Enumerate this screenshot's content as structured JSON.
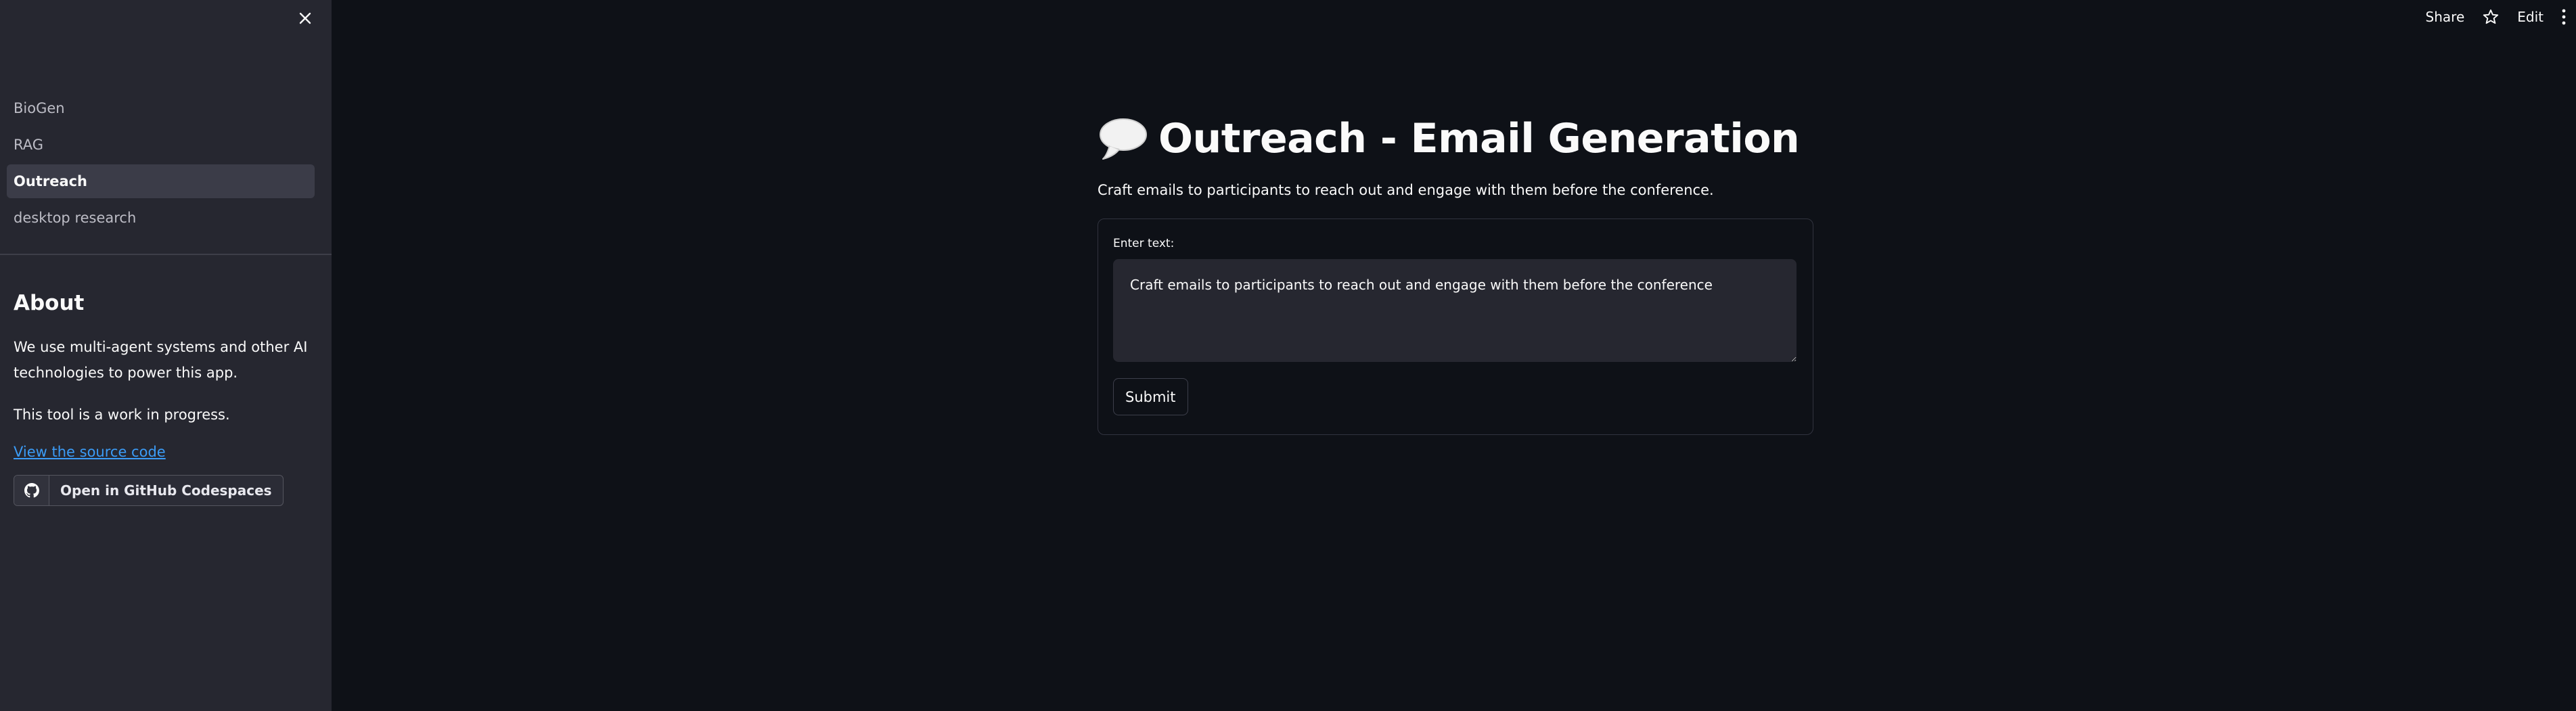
{
  "toolbar": {
    "share_label": "Share",
    "edit_label": "Edit"
  },
  "sidebar": {
    "items": [
      {
        "label": "BioGen",
        "active": false
      },
      {
        "label": "RAG",
        "active": false
      },
      {
        "label": "Outreach",
        "active": true
      },
      {
        "label": "desktop research",
        "active": false
      }
    ],
    "about": {
      "heading": "About",
      "paragraph_1": "We use multi-agent systems and other AI technologies to power this app.",
      "paragraph_2": "This tool is a work in progress.",
      "link_text": "View the source code",
      "codespaces_button": "Open in GitHub Codespaces"
    }
  },
  "main": {
    "title_icon": "speech-balloon-icon",
    "title": "Outreach - Email Generation",
    "subtitle": "Craft emails to participants to reach out and engage with them before the conference.",
    "form": {
      "label": "Enter text:",
      "textarea_value": "Craft emails to participants to reach out and engage with them before the conference",
      "submit_label": "Submit"
    }
  },
  "colors": {
    "background": "#0e1117",
    "sidebar": "#262730",
    "link": "#3b9cf7"
  }
}
